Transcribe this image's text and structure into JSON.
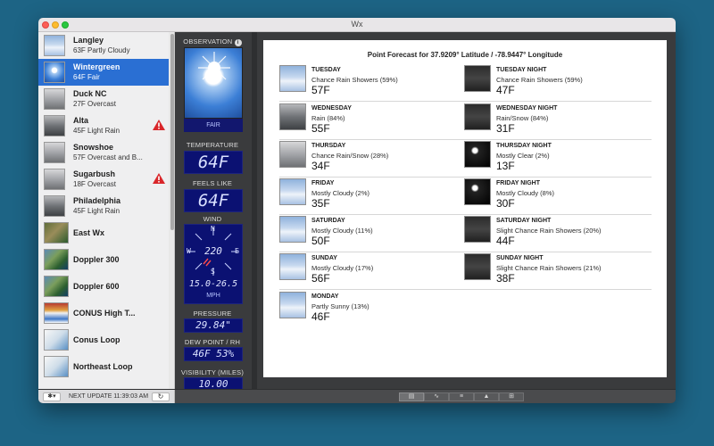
{
  "window": {
    "title": "Wx"
  },
  "sidebar": {
    "items": [
      {
        "name": "Langley",
        "sub": "63F Partly Cloudy",
        "thumb": "cloudy",
        "warning": false
      },
      {
        "name": "Wintergreen",
        "sub": "64F Fair",
        "thumb": "sunny",
        "warning": false,
        "selected": true
      },
      {
        "name": "Duck NC",
        "sub": "27F Overcast",
        "thumb": "overcast",
        "warning": false
      },
      {
        "name": "Alta",
        "sub": "45F Light Rain",
        "thumb": "rainy",
        "warning": true
      },
      {
        "name": "Snowshoe",
        "sub": "57F Overcast and B...",
        "thumb": "overcast",
        "warning": false
      },
      {
        "name": "Sugarbush",
        "sub": "18F Overcast",
        "thumb": "overcast",
        "warning": true
      },
      {
        "name": "Philadelphia",
        "sub": "45F Light Rain",
        "thumb": "rainy",
        "warning": false
      },
      {
        "name": "East Wx",
        "sub": "",
        "thumb": "map1",
        "warning": false
      },
      {
        "name": "Doppler 300",
        "sub": "",
        "thumb": "map2",
        "warning": false
      },
      {
        "name": "Doppler 600",
        "sub": "",
        "thumb": "map2",
        "warning": false
      },
      {
        "name": "CONUS High T...",
        "sub": "",
        "thumb": "map3",
        "warning": false
      },
      {
        "name": "Conus Loop",
        "sub": "",
        "thumb": "map4",
        "warning": false
      },
      {
        "name": "Northeast Loop",
        "sub": "",
        "thumb": "map4",
        "warning": false
      }
    ]
  },
  "bottom": {
    "next_update": "NEXT UPDATE 11:39:03 AM",
    "gear_icon": "gear-icon",
    "refresh_icon": "refresh-icon",
    "segments": [
      "list-view-icon",
      "graph-icon",
      "text-view-icon",
      "alerts-icon",
      "grid-view-icon"
    ]
  },
  "observation": {
    "header": "OBSERVATION",
    "condition": "FAIR",
    "temperature_label": "TEMPERATURE",
    "temperature": "64F",
    "feels_like_label": "FEELS LIKE",
    "feels_like": "64F",
    "wind_label": "WIND",
    "wind_direction": "220",
    "wind_speed": "15.0-26.5",
    "wind_unit": "MPH",
    "compass": {
      "n": "N",
      "s": "S",
      "e": "E",
      "w": "W"
    },
    "pressure_label": "PRESSURE",
    "pressure": "29.84\"",
    "dew_label": "DEW POINT / RH",
    "dew": "46F 53%",
    "visibility_label": "VISIBILITY (MILES)",
    "visibility": "10.00"
  },
  "forecast": {
    "title": "Point Forecast for 37.9209° Latitude / -78.9447° Longitude",
    "periods": [
      {
        "period": "TUESDAY",
        "desc": "Chance Rain Showers (59%)",
        "temp": "57F",
        "img": "cloudy"
      },
      {
        "period": "TUESDAY NIGHT",
        "desc": "Chance Rain Showers (59%)",
        "temp": "47F",
        "img": "nightcloud"
      },
      {
        "period": "WEDNESDAY",
        "desc": "Rain (84%)",
        "temp": "55F",
        "img": "rainy"
      },
      {
        "period": "WEDNESDAY NIGHT",
        "desc": "Rain/Snow (84%)",
        "temp": "31F",
        "img": "nightcloud"
      },
      {
        "period": "THURSDAY",
        "desc": "Chance Rain/Snow (28%)",
        "temp": "34F",
        "img": "overcast"
      },
      {
        "period": "THURSDAY NIGHT",
        "desc": "Mostly Clear (2%)",
        "temp": "13F",
        "img": "night"
      },
      {
        "period": "FRIDAY",
        "desc": "Mostly Cloudy (2%)",
        "temp": "35F",
        "img": "cloudy"
      },
      {
        "period": "FRIDAY NIGHT",
        "desc": "Mostly Cloudy (8%)",
        "temp": "30F",
        "img": "night"
      },
      {
        "period": "SATURDAY",
        "desc": "Mostly Cloudy (11%)",
        "temp": "50F",
        "img": "cloudy"
      },
      {
        "period": "SATURDAY NIGHT",
        "desc": "Slight Chance Rain Showers (20%)",
        "temp": "44F",
        "img": "nightcloud"
      },
      {
        "period": "SUNDAY",
        "desc": "Mostly Cloudy (17%)",
        "temp": "56F",
        "img": "cloudy"
      },
      {
        "period": "SUNDAY NIGHT",
        "desc": "Slight Chance Rain Showers (21%)",
        "temp": "38F",
        "img": "nightcloud"
      },
      {
        "period": "MONDAY",
        "desc": "Partly Sunny (13%)",
        "temp": "46F",
        "img": "cloudy"
      }
    ]
  },
  "colors": {
    "desktop": "#1d6485",
    "selection": "#2a6fd3",
    "lcd": "#0b1172",
    "warning": "#d9262a"
  }
}
